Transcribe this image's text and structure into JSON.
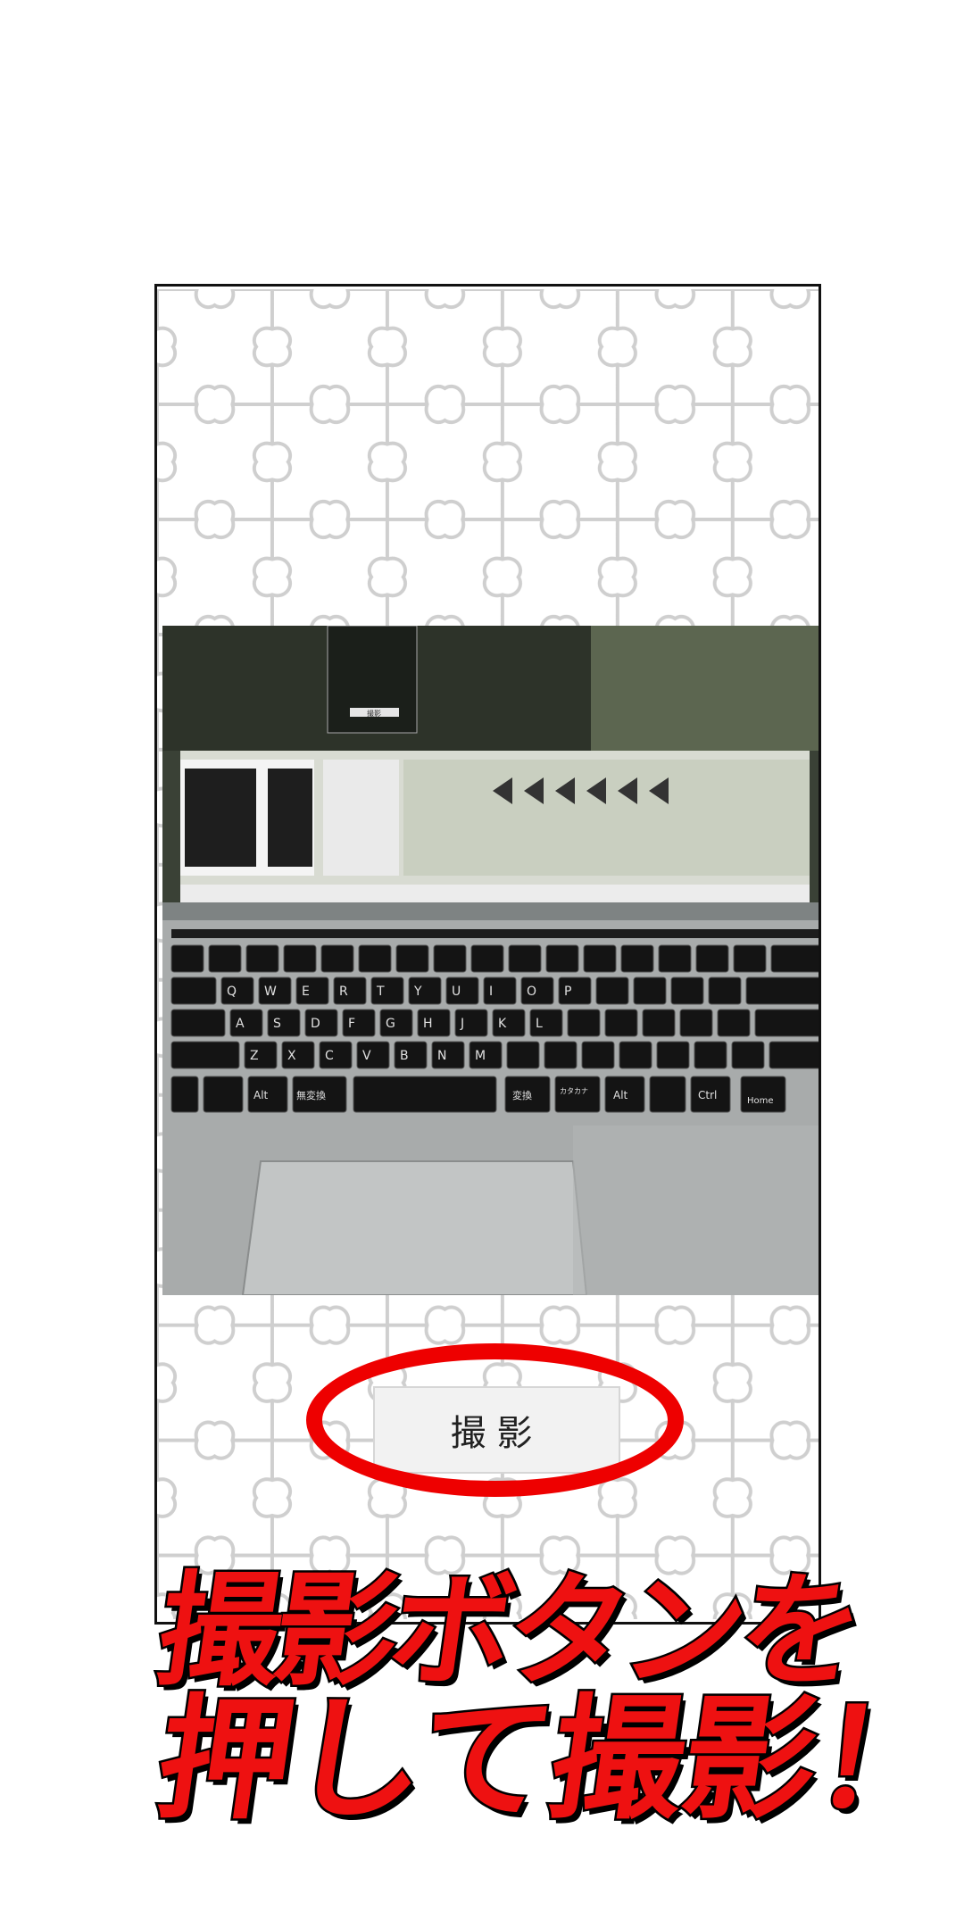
{
  "camera_screen": {
    "shutter_label": "撮影"
  },
  "caption": {
    "line1": "撮影ボタンを",
    "line2": "押して撮影！"
  },
  "photo": {
    "description_icon": "laptop-photo",
    "preview_button_label": "撮影",
    "keys_row1": [
      "Q",
      "W",
      "E",
      "R",
      "T",
      "Y",
      "U",
      "I",
      "O",
      "P"
    ],
    "keys_row2": [
      "A",
      "S",
      "D",
      "F",
      "G",
      "H",
      "J",
      "K",
      "L"
    ],
    "keys_row3": [
      "Z",
      "X",
      "C",
      "V",
      "B",
      "N",
      "M"
    ],
    "keys_row4": [
      "Alt",
      "無変換",
      "変換",
      "カタカナ",
      "Alt",
      "Ctrl",
      "Home"
    ],
    "accent_color": "#ee0000"
  }
}
